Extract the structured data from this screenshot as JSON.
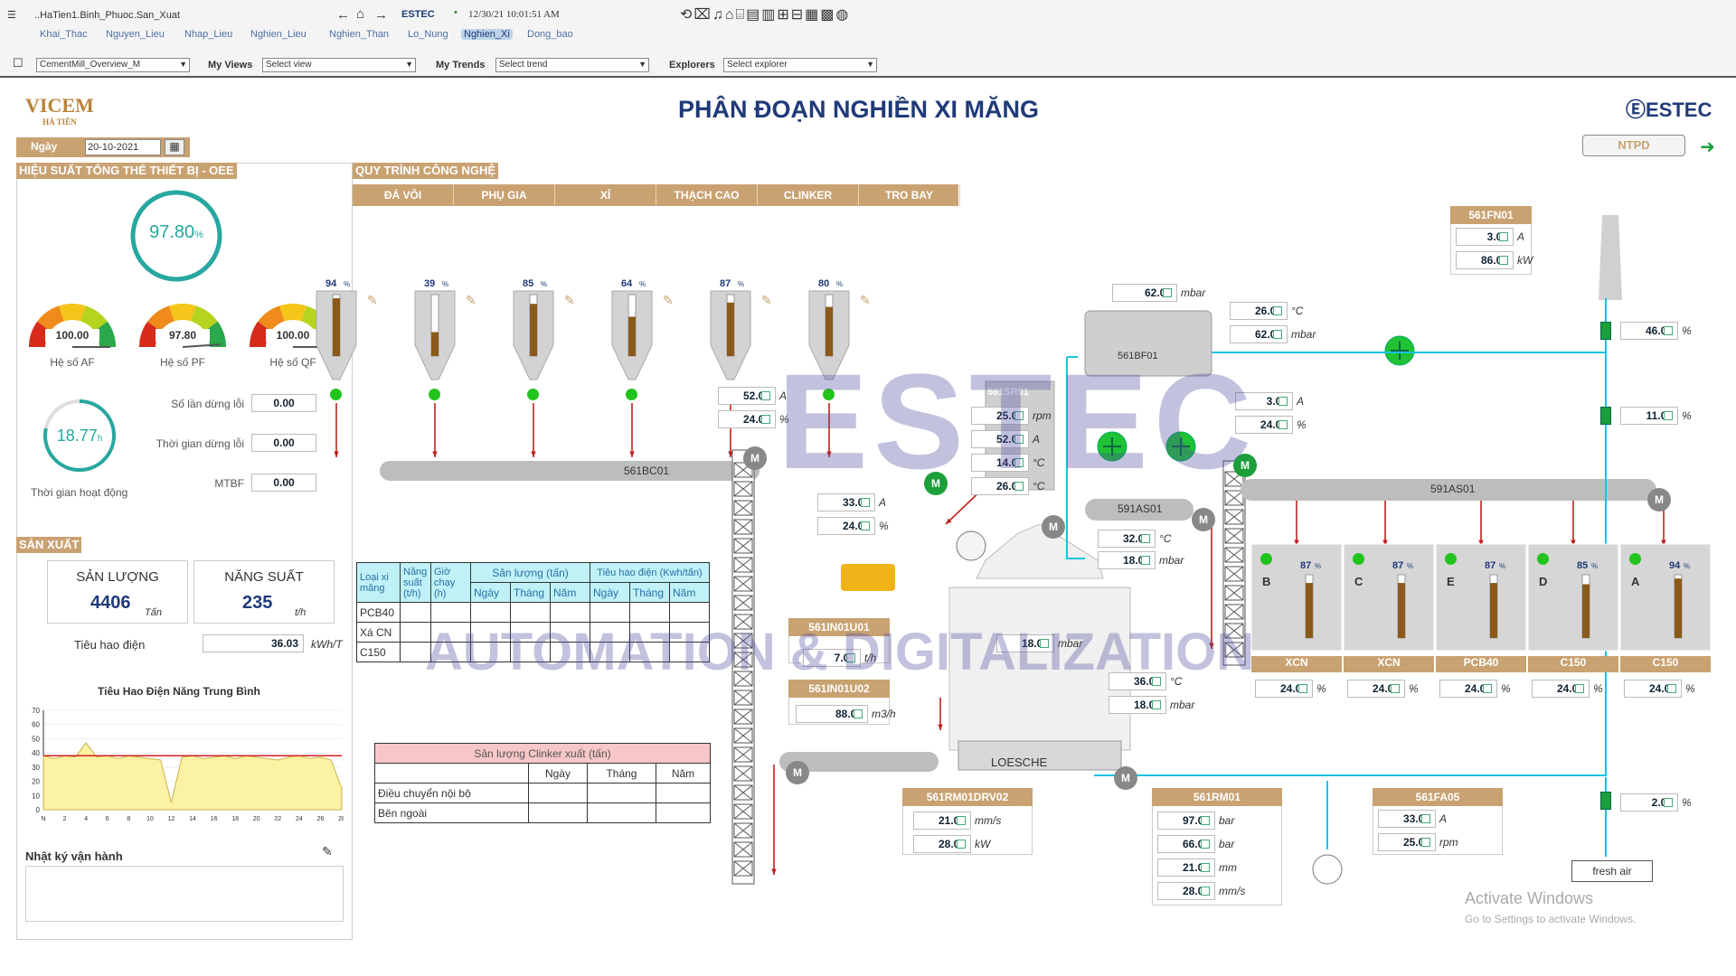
{
  "topbar": {
    "path": "..HaTien1.Binh_Phuoc.San_Xuat",
    "timestamp": "12/30/21 10:01:51 AM",
    "brand": "ESTEC",
    "nav": [
      "Khai_Thac",
      "Nguyen_Lieu",
      "Nhap_Lieu",
      "Nghien_Lieu",
      "Nghien_Than",
      "Lo_Nung",
      "Nghien_Xi",
      "Dong_bao"
    ],
    "active_nav": "Nghien_Xi",
    "overview": "CementMill_Overview_M",
    "my_views_label": "My Views",
    "my_views_value": "Select view",
    "my_trends_label": "My Trends",
    "my_trends_value": "Select trend",
    "explorers_label": "Explorers",
    "explorers_value": "Select explorer"
  },
  "page": {
    "logo": "VICEM",
    "logo_sub": "HÀ TIÊN",
    "title": "PHÂN ĐOẠN NGHIỀN XI MĂNG",
    "brand": "ESTEC",
    "date_label": "Ngày",
    "date_value": "20-10-2021",
    "ntpd_button": "NTPD"
  },
  "oee": {
    "header": "HIỆU SUẤT TỔNG THỂ THIẾT BỊ - OEE",
    "oee_value": "97.80",
    "oee_unit": "%",
    "gauges": [
      {
        "value": "100.00",
        "unit": "%",
        "label": "Hệ số AF",
        "level": 1.0
      },
      {
        "value": "97.80",
        "unit": "%",
        "label": "Hệ số PF",
        "level": 0.978
      },
      {
        "value": "100.00",
        "unit": "%",
        "label": "Hệ số QF",
        "level": 1.0
      }
    ],
    "runtime_value": "18.77",
    "runtime_unit": "h",
    "runtime_label": "Thời gian hoạt động",
    "stats": [
      {
        "label": "Số lần dừng lỗi",
        "value": "0.00"
      },
      {
        "label": "Thời gian dừng lỗi",
        "value": "0.00"
      },
      {
        "label": "MTBF",
        "value": "0.00"
      }
    ]
  },
  "production": {
    "header": "SẢN XUẤT",
    "output_label": "SẢN LƯỢNG",
    "output_value": "4406",
    "output_unit": "Tấn",
    "rate_label": "NĂNG SUẤT",
    "rate_value": "235",
    "rate_unit": "t/h",
    "power_label": "Tiêu hao điện",
    "power_value": "36.03",
    "power_unit": "kWh/T",
    "chart_title": "Tiêu Hao Điện Năng Trung Bình",
    "log_label": "Nhật ký vận hành"
  },
  "chart_data": {
    "type": "area",
    "title": "Tiêu Hao Điện Năng Trung Bình",
    "ylim": [
      0,
      70
    ],
    "yticks": [
      0,
      10,
      20,
      30,
      40,
      50,
      60,
      70
    ],
    "x": [
      "N",
      "2",
      "4",
      "6",
      "8",
      "10",
      "12",
      "14",
      "16",
      "18",
      "20",
      "22",
      "24",
      "26",
      "28"
    ],
    "values": [
      38,
      36,
      38,
      37,
      47,
      37,
      38,
      36,
      38,
      37,
      36,
      35,
      5,
      37,
      38,
      36,
      37,
      38,
      36,
      38,
      37,
      36,
      35,
      37,
      38,
      36,
      37,
      35,
      15
    ],
    "target": 38
  },
  "process": {
    "header": "QUY TRÌNH CÔNG NGHỆ",
    "tabs": [
      "ĐÁ VÔI",
      "PHỤ GIA",
      "XỈ",
      "THẠCH CAO",
      "CLINKER",
      "TRO BAY"
    ],
    "silos": [
      {
        "pct": "94",
        "level": 0.94
      },
      {
        "pct": "39",
        "level": 0.39
      },
      {
        "pct": "85",
        "level": 0.85
      },
      {
        "pct": "64",
        "level": 0.64
      },
      {
        "pct": "87",
        "level": 0.87
      },
      {
        "pct": "80",
        "level": 0.8
      }
    ],
    "conveyor1": "561BC01",
    "conveyor2": "591AS01",
    "filter": "561BF01",
    "separator": "561SR01",
    "slide": "591AS01",
    "mill": "LOESCHE",
    "fan_tag": "561FN01",
    "fan_vals": [
      {
        "v": "3.00",
        "u": "A"
      },
      {
        "v": "86.00",
        "u": "kW"
      }
    ],
    "bf_vals": [
      {
        "v": "62.00",
        "u": "mbar"
      }
    ],
    "stack_vals": [
      {
        "v": "26.00",
        "u": "°C"
      },
      {
        "v": "62.00",
        "u": "mbar"
      }
    ],
    "sr_vals": [
      {
        "v": "25.00",
        "u": "rpm"
      },
      {
        "v": "52.00",
        "u": "A"
      },
      {
        "v": "14.00",
        "u": "°C"
      },
      {
        "v": "26.00",
        "u": "°C"
      }
    ],
    "feed_vals": [
      {
        "v": "52.00",
        "u": "A"
      },
      {
        "v": "24.00",
        "u": "%"
      }
    ],
    "m_vals": [
      {
        "v": "33.00",
        "u": "A"
      },
      {
        "v": "24.00",
        "u": "%"
      }
    ],
    "as_vals": [
      {
        "v": "3.00",
        "u": "A"
      },
      {
        "v": "24.00",
        "u": "%"
      }
    ],
    "damper_vals": [
      {
        "v": "46.00",
        "u": "%"
      },
      {
        "v": "11.00",
        "u": "%"
      },
      {
        "v": "2.00",
        "u": "%"
      }
    ],
    "mill_in": [
      {
        "v": "32.00",
        "u": "°C"
      },
      {
        "v": "18.00",
        "u": "mbar"
      }
    ],
    "mill_dp": {
      "v": "18.00",
      "u": "mbar"
    },
    "mill_out": [
      {
        "v": "36.00",
        "u": "°C"
      },
      {
        "v": "18.00",
        "u": "mbar"
      }
    ],
    "in1_tag": "561IN01U01",
    "in1": {
      "v": "7.00",
      "u": "t/h"
    },
    "in2_tag": "561IN01U02",
    "in2": {
      "v": "88.00",
      "u": "m3/h"
    },
    "drv_tag": "561RM01DRV02",
    "drv_vals": [
      {
        "v": "21.00",
        "u": "mm/s"
      },
      {
        "v": "28.00",
        "u": "kW"
      }
    ],
    "rm_tag": "561RM01",
    "rm_vals": [
      {
        "v": "97.00",
        "u": "bar"
      },
      {
        "v": "66.00",
        "u": "bar"
      },
      {
        "v": "21.00",
        "u": "mm"
      },
      {
        "v": "28.00",
        "u": "mm/s"
      }
    ],
    "fa_tag": "561FA05",
    "fa_vals": [
      {
        "v": "33.00",
        "u": "A"
      },
      {
        "v": "25.00",
        "u": "rpm"
      }
    ],
    "fresh_air": "fresh air",
    "bins": [
      {
        "id": "B",
        "pct": "87",
        "level": 0.87,
        "label": "XCN",
        "val": "24.00"
      },
      {
        "id": "C",
        "pct": "87",
        "level": 0.87,
        "label": "XCN",
        "val": "24.00"
      },
      {
        "id": "E",
        "pct": "87",
        "level": 0.87,
        "label": "PCB40",
        "val": "24.00"
      },
      {
        "id": "D",
        "pct": "85",
        "level": 0.85,
        "label": "C150",
        "val": "24.00"
      },
      {
        "id": "A",
        "pct": "94",
        "level": 0.94,
        "label": "C150",
        "val": "24.00"
      }
    ],
    "bin_unit": "%"
  },
  "table1": {
    "headers": [
      "Loại xi măng",
      "Năng suất (t/h)",
      "Giờ chạy (h)",
      "Sản lượng (tấn)",
      "Tiêu hao điện (Kwh/tấn)"
    ],
    "sub": [
      "Ngày",
      "Tháng",
      "Năm",
      "Ngày",
      "Tháng",
      "Năm"
    ],
    "rows": [
      "PCB40",
      "Xá CN",
      "C150"
    ]
  },
  "table2": {
    "title": "Sản lượng Clinker xuất (tấn)",
    "cols": [
      "Ngày",
      "Tháng",
      "Năm"
    ],
    "rows": [
      "Điều chuyển nội bộ",
      "Bên ngoài"
    ]
  },
  "watermark": {
    "line1": "ESTEC",
    "line2": "AUTOMATION & DIGITALIZATION"
  },
  "activate": {
    "line1": "Activate Windows",
    "line2": "Go to Settings to activate Windows."
  },
  "colors": {
    "accent": "#c9a272",
    "title": "#1f3a78",
    "line": "#19c3e0",
    "arrow": "#c0211d",
    "green": "#1c9e3a"
  }
}
